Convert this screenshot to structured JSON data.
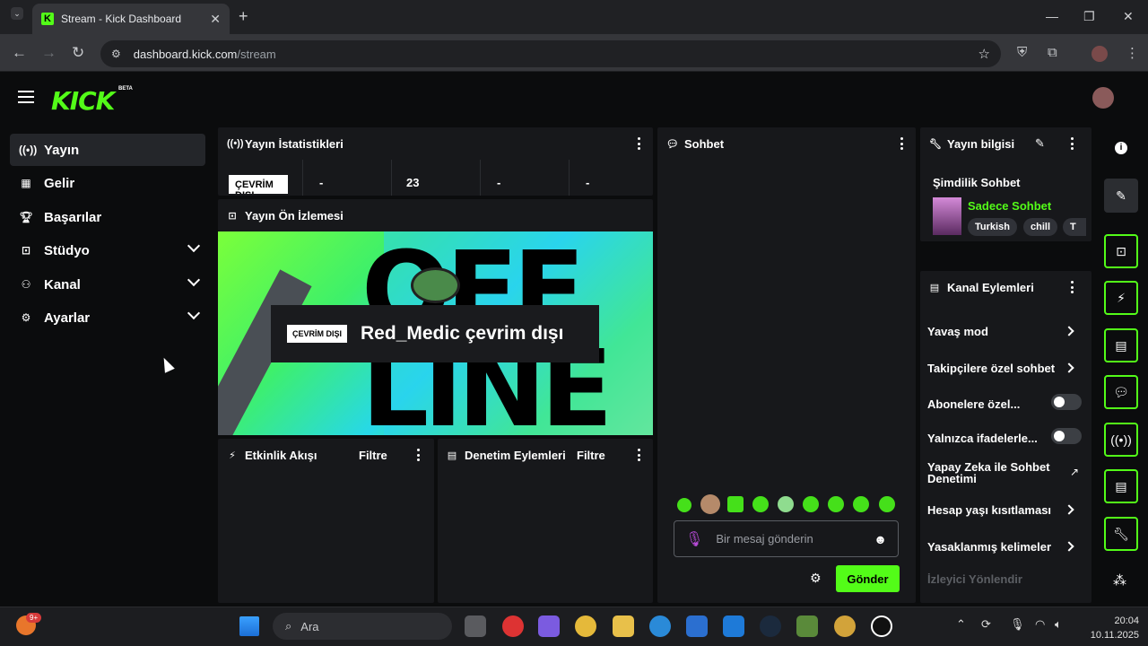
{
  "browser": {
    "tab_title": "Stream - Kick Dashboard",
    "new_tab": "+",
    "url_host": "dashboard.kick.com",
    "url_path": "/stream"
  },
  "app": {
    "logo": "KICK",
    "beta": "BETA"
  },
  "sidebar": {
    "items": [
      {
        "label": "Yayın",
        "icon": "broadcast-icon"
      },
      {
        "label": "Gelir",
        "icon": "revenue-icon"
      },
      {
        "label": "Başarılar",
        "icon": "trophy-icon"
      },
      {
        "label": "Stüdyo",
        "icon": "studio-icon"
      },
      {
        "label": "Kanal",
        "icon": "channel-icon"
      },
      {
        "label": "Ayarlar",
        "icon": "gear-icon"
      }
    ]
  },
  "stats": {
    "title": "Yayın İstatistikleri",
    "status": "ÇEVRİM DIŞI",
    "values": [
      "-",
      "23",
      "-",
      "-"
    ]
  },
  "preview": {
    "title": "Yayın Ön İzlemesi",
    "badge": "ÇEVRİM DIŞI",
    "message": "Red_Medic çevrim dışı"
  },
  "activity": {
    "title": "Etkinlik Akışı",
    "filter": "Filtre"
  },
  "moderation": {
    "title": "Denetim Eylemleri",
    "filter": "Filtre"
  },
  "chat": {
    "title": "Sohbet",
    "placeholder": "Bir mesaj gönderin",
    "send": "Gönder"
  },
  "stream_info": {
    "title": "Yayın bilgisi",
    "category_label": "Şimdilik Sohbet",
    "stream_title": "Sadece Sohbet",
    "tags": [
      "Turkish",
      "chill",
      "T"
    ]
  },
  "channel_actions": {
    "title": "Kanal Eylemleri",
    "items": [
      {
        "label": "Yavaş mod",
        "control": "arrow"
      },
      {
        "label": "Takipçilere özel sohbet",
        "control": "arrow"
      },
      {
        "label": "Abonelere özel...",
        "control": "toggle"
      },
      {
        "label": "Yalnızca ifadelerle...",
        "control": "toggle"
      },
      {
        "label": "Yapay Zeka ile Sohbet Denetimi",
        "control": "external"
      },
      {
        "label": "Hesap yaşı kısıtlaması",
        "control": "arrow"
      },
      {
        "label": "Yasaklanmış kelimeler",
        "control": "arrow"
      },
      {
        "label": "İzleyici Yönlendir",
        "control": "none"
      }
    ]
  },
  "taskbar": {
    "search": "Ara",
    "notif_badge": "9+",
    "time": "20:04",
    "date": "10.11.2025"
  },
  "colors": {
    "accent": "#53fc18",
    "panel": "#17181b",
    "bg": "#0b0c0d"
  }
}
